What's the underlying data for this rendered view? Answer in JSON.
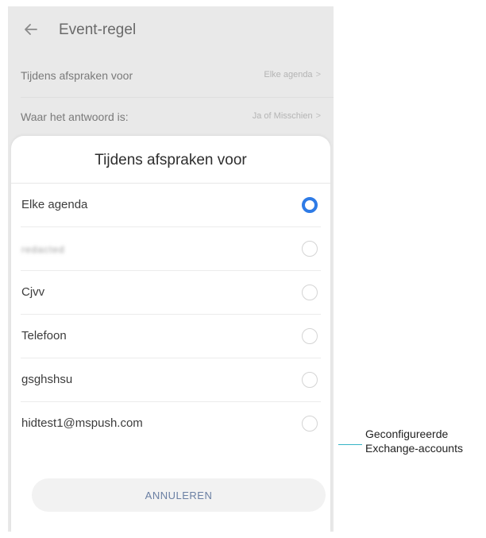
{
  "appbar": {
    "title": "Event-regel"
  },
  "settings": [
    {
      "label": "Tijdens afspraken voor",
      "value": "Elke agenda"
    },
    {
      "label": "Waar het antwoord is:",
      "value": "Ja of Misschien"
    }
  ],
  "dialog": {
    "title": "Tijdens afspraken voor",
    "options": [
      {
        "label": "Elke agenda",
        "selected": true
      },
      {
        "label": "redacted",
        "selected": false
      },
      {
        "label": "Cjvv",
        "selected": false
      },
      {
        "label": "Telefoon",
        "selected": false
      },
      {
        "label": "gsghshsu",
        "selected": false
      },
      {
        "label": "hidtest1@mspush.com",
        "selected": false
      }
    ],
    "cancel_label": "ANNULEREN"
  },
  "callout": {
    "line1": "Geconfigureerde",
    "line2": "Exchange-accounts"
  },
  "colors": {
    "accent": "#2e7be6",
    "callout_line": "#36b4c6"
  }
}
